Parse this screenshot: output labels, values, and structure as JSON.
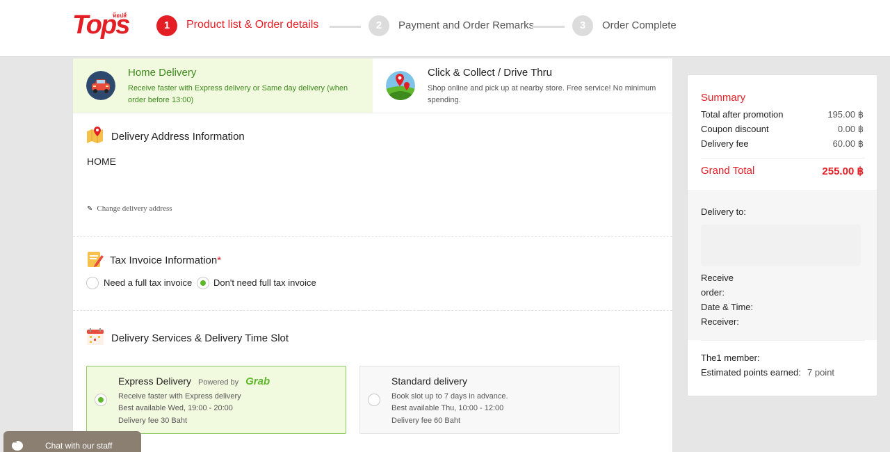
{
  "header": {
    "logo_text": "Tops",
    "logo_thai": "ท็อปส์",
    "steps": [
      {
        "number": "1",
        "label": "Product list & Order details"
      },
      {
        "number": "2",
        "label": "Payment and Order Remarks"
      },
      {
        "number": "3",
        "label": "Order Complete"
      }
    ]
  },
  "methods": {
    "home": {
      "title": "Home Delivery",
      "desc": "Receive faster with Express delivery or Same day delivery (when order before 13:00)"
    },
    "collect": {
      "title": "Click & Collect / Drive Thru",
      "desc": "Shop online and pick up at nearby store. Free service! No minimum spending."
    }
  },
  "address": {
    "title": "Delivery Address Information",
    "name": "HOME",
    "change_label": "Change delivery address"
  },
  "tax": {
    "title": "Tax Invoice Information",
    "required_mark": "*",
    "option_full": "Need a full tax invoice",
    "option_none": "Don't need full tax invoice"
  },
  "services": {
    "title": "Delivery Services & Delivery Time Slot",
    "express": {
      "title": "Express Delivery",
      "powered_by": "Powered by",
      "partner": "Grab",
      "line1": "Receive faster with Express delivery",
      "line2": "Best available Wed, 19:00 - 20:00",
      "line3": "Delivery fee 30 Baht"
    },
    "standard": {
      "title": "Standard delivery",
      "line1": "Book slot up to 7 days in advance.",
      "line2": "Best available Thu, 10:00 - 12:00",
      "line3": "Delivery fee 60 Baht"
    }
  },
  "summary": {
    "title": "Summary",
    "rows": [
      {
        "label": "Total after promotion",
        "value": "195.00 ฿"
      },
      {
        "label": "Coupon discount",
        "value": "0.00 ฿"
      },
      {
        "label": "Delivery fee",
        "value": "60.00 ฿"
      }
    ],
    "grand_total_label": "Grand Total",
    "grand_total_value": "255.00 ฿",
    "delivery_to": "Delivery to:",
    "receive_order": "Receive",
    "receive_order_2": "order:",
    "date_time": "Date & Time:",
    "receiver": "Receiver:",
    "member": "The1 member:",
    "points_label": "Estimated points earned:",
    "points_value": "7 point"
  },
  "chat": {
    "label": "Chat with our staff"
  },
  "colors": {
    "brand": "#e31e24",
    "green": "#5fb72b"
  }
}
